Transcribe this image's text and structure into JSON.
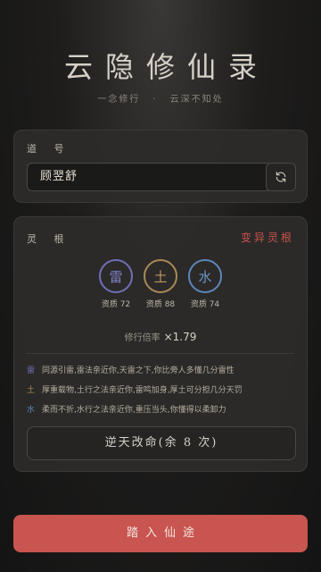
{
  "app": {
    "title": "云隐修仙录",
    "subtitle_left": "一念修行",
    "subtitle_sep": "·",
    "subtitle_right": "云深不知处"
  },
  "name_section": {
    "label": "道 号",
    "value": "顾翌舒",
    "refresh_icon": "refresh-icon"
  },
  "root_section": {
    "label": "灵 根",
    "mutant_label": "变异灵根",
    "elements": [
      {
        "char": "雷",
        "quality_label": "资质 72",
        "quality": 72,
        "color": "#6f6fb8"
      },
      {
        "char": "土",
        "quality_label": "资质 88",
        "quality": 88,
        "color": "#a88a55"
      },
      {
        "char": "水",
        "quality_label": "资质 74",
        "quality": 74,
        "color": "#5d86b8"
      }
    ],
    "rate_label": "修行倍率",
    "rate_value": "×1.79",
    "descriptions": [
      {
        "el": "雷",
        "text": "同源引雷,雷法亲近你,天雷之下,你比旁人多懂几分雷性",
        "color": "#6f6fb8"
      },
      {
        "el": "土",
        "text": "厚重载物,土行之法亲近你,雷鸣加身,厚土可分担几分天罚",
        "color": "#a88a55"
      },
      {
        "el": "水",
        "text": "柔而不折,水行之法亲近你,重压当头,你懂得以柔卸力",
        "color": "#5d86b8"
      }
    ],
    "reroll_label": "逆天改命(余 8 次)"
  },
  "enter_button": "踏入仙途",
  "colors": {
    "accent": "#c8554f",
    "mutant": "#c9534b"
  }
}
